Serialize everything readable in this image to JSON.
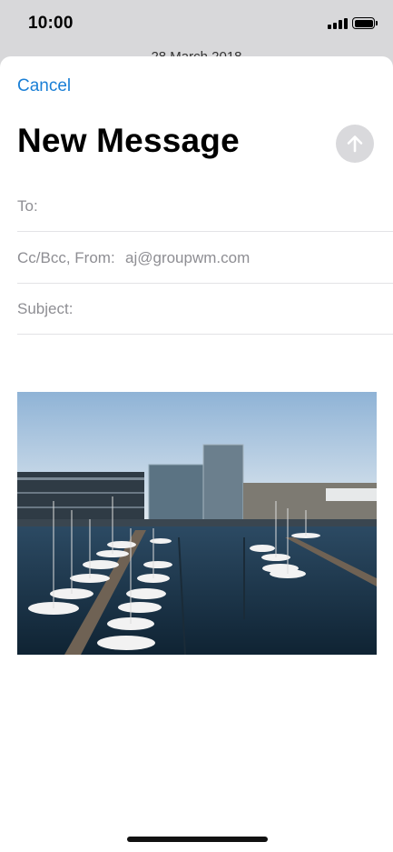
{
  "status_bar": {
    "time": "10:00",
    "behind_text": "28 March 2018"
  },
  "compose": {
    "cancel_label": "Cancel",
    "title": "New Message",
    "send_icon": "arrow-up-icon",
    "to": {
      "label": "To:",
      "value": ""
    },
    "cc_from": {
      "label": "Cc/Bcc, From:",
      "value": "aj@groupwm.com"
    },
    "subject": {
      "label": "Subject:",
      "value": ""
    },
    "attachment": {
      "icon": "image-attachment"
    }
  },
  "colors": {
    "accent": "#1a7fd6",
    "send_disabled": "#d9d9dc",
    "placeholder": "#8e8e93"
  }
}
